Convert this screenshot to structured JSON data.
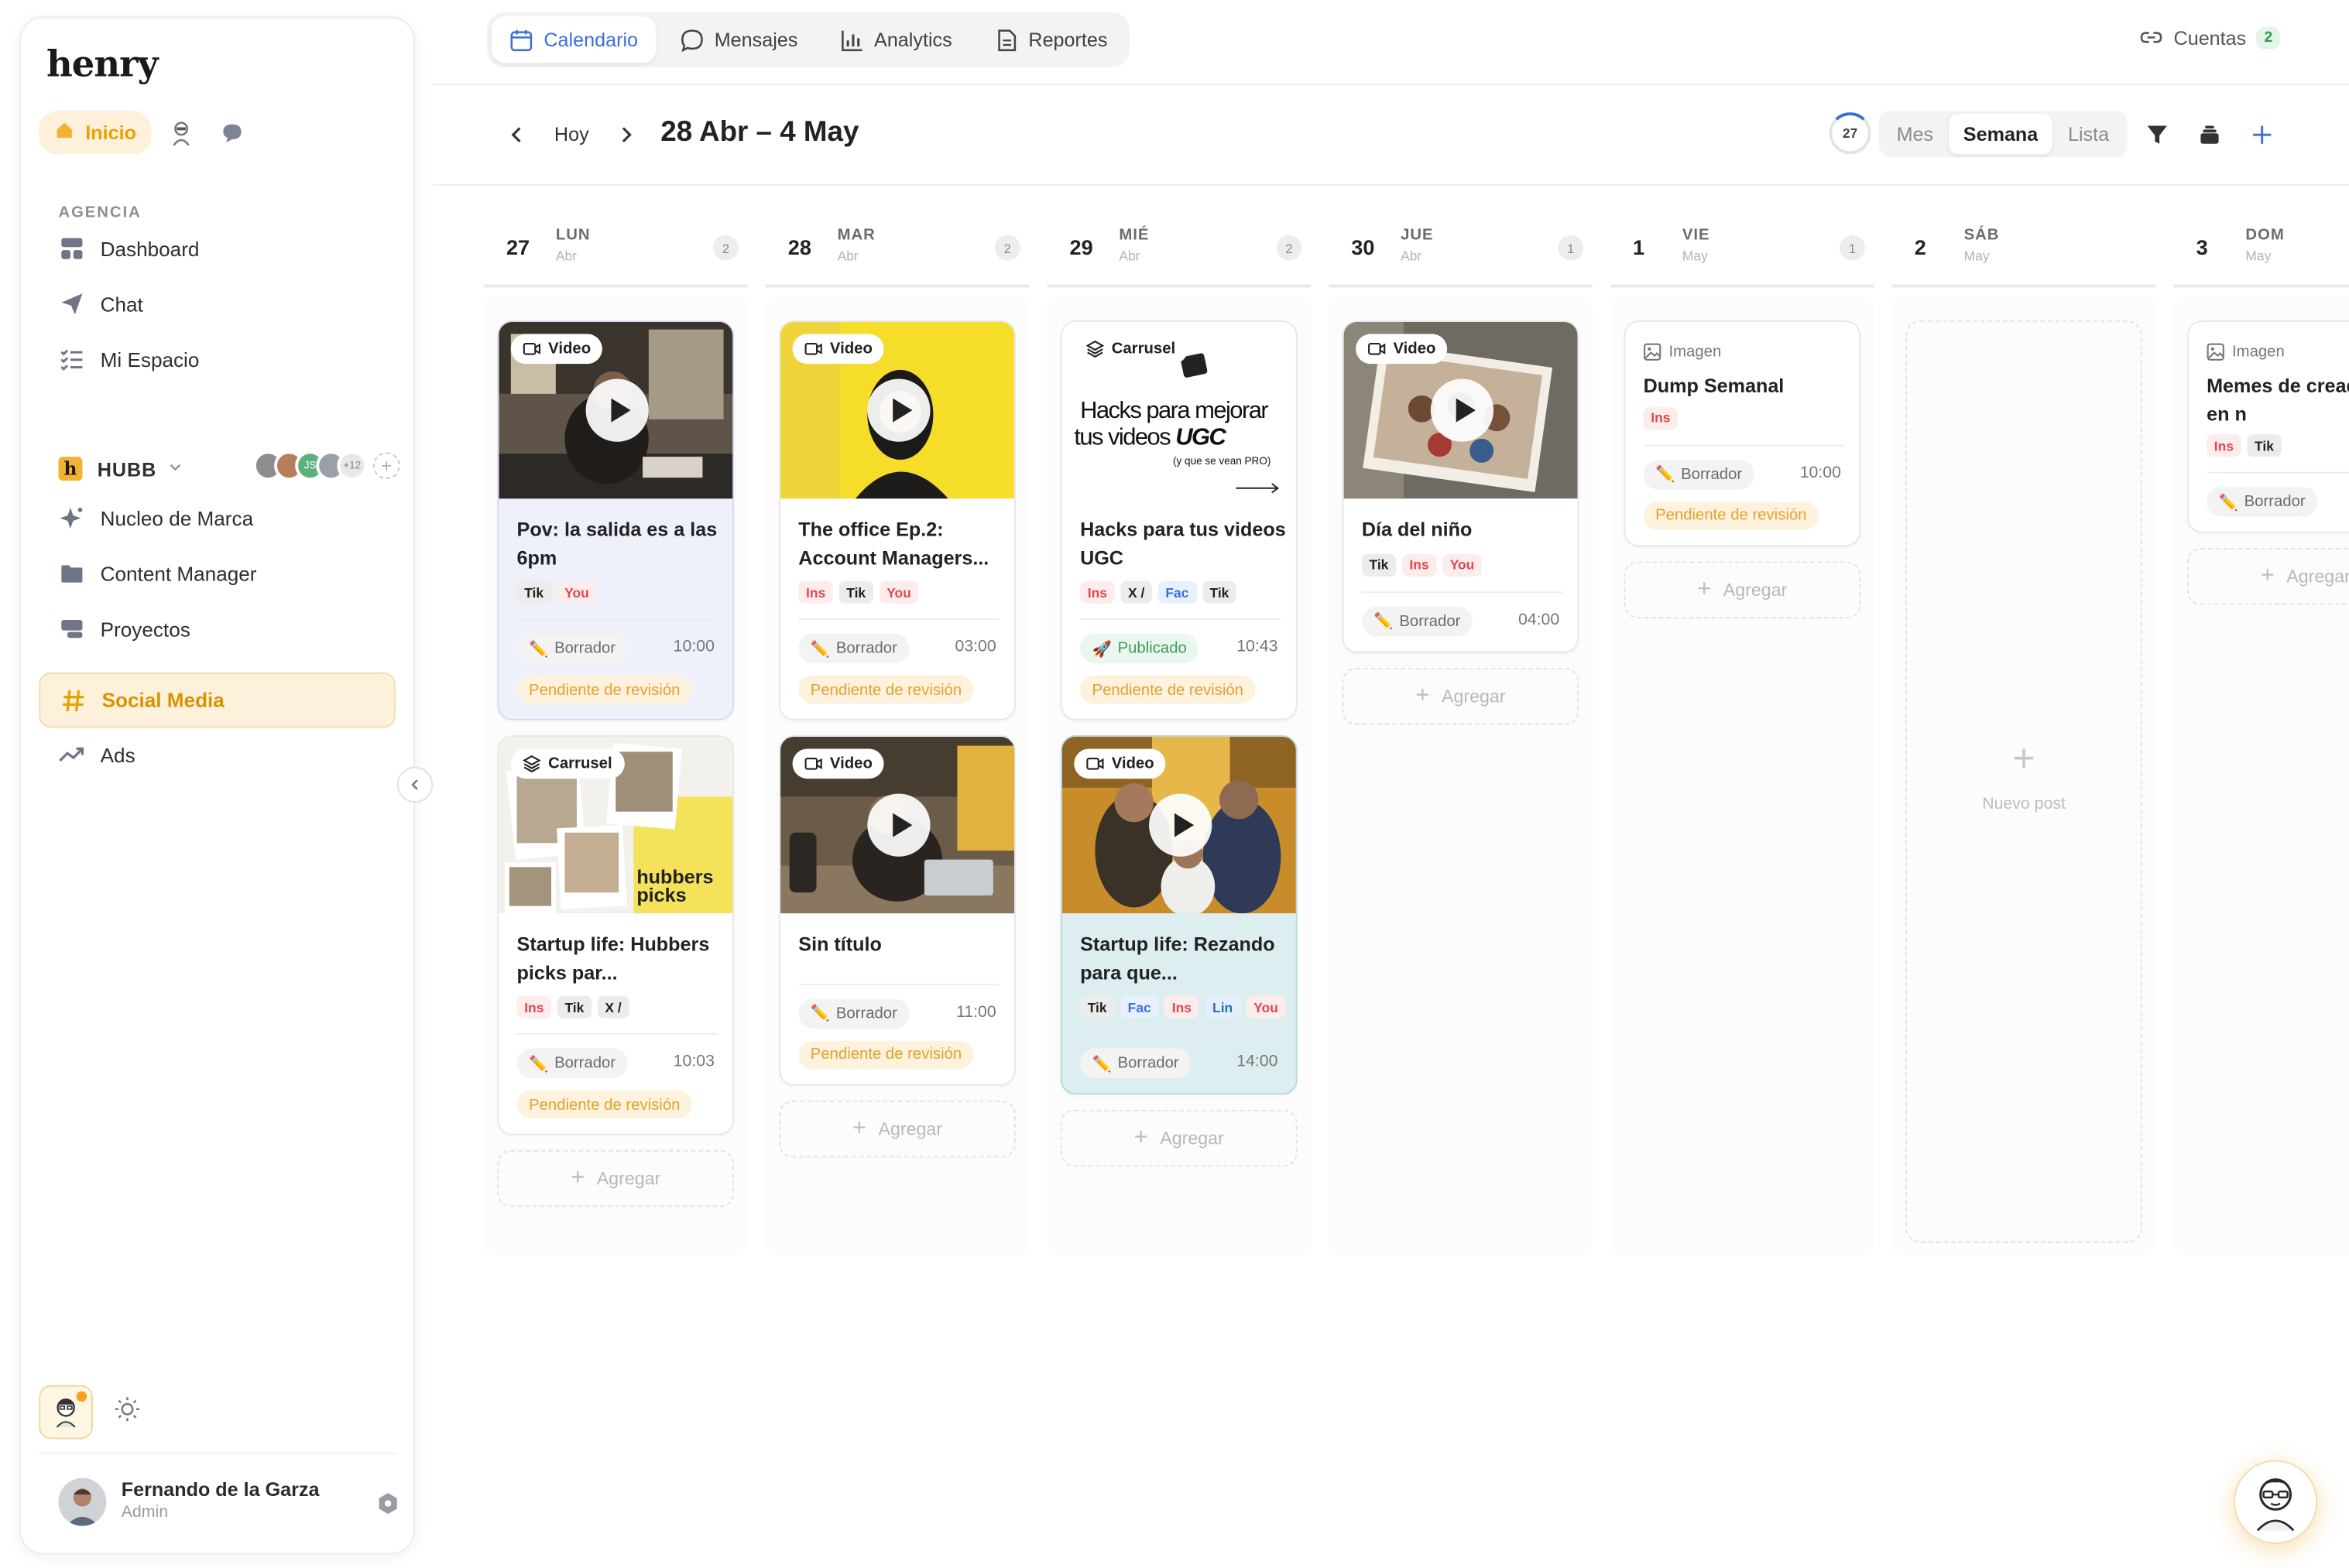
{
  "brand": {
    "logo": "henry",
    "accent": "#e8a200",
    "link_blue": "#3b6fd8"
  },
  "sidebar": {
    "top_tabs": {
      "inicio": "Inicio"
    },
    "section_label": "AGENCIA",
    "agency_items": [
      {
        "label": "Dashboard",
        "icon": "dashboard-icon"
      },
      {
        "label": "Chat",
        "icon": "send-icon"
      },
      {
        "label": "Mi Espacio",
        "icon": "checklist-icon"
      }
    ],
    "workspace": {
      "name": "HUBB",
      "logo_letter": "h",
      "members": [
        "JS",
        "+12"
      ]
    },
    "workspace_items": [
      {
        "label": "Nucleo de Marca",
        "icon": "sparkle-icon"
      },
      {
        "label": "Content Manager",
        "icon": "folder-icon"
      },
      {
        "label": "Proyectos",
        "icon": "projects-icon"
      },
      {
        "label": "Social Media",
        "icon": "hashtag-icon",
        "active": true
      },
      {
        "label": "Ads",
        "icon": "trend-icon"
      }
    ],
    "user": {
      "name": "Fernando de la Garza",
      "role": "Admin"
    }
  },
  "topnav": {
    "tabs": [
      {
        "label": "Calendario",
        "icon": "calendar-icon",
        "active": true
      },
      {
        "label": "Mensajes",
        "icon": "message-icon"
      },
      {
        "label": "Analytics",
        "icon": "bar-chart-icon"
      },
      {
        "label": "Reportes",
        "icon": "document-icon"
      }
    ],
    "cuentas": {
      "label": "Cuentas",
      "count": "2"
    }
  },
  "toolbar": {
    "today": "Hoy",
    "range": "28 Abr – 4 May",
    "circle_day": "27",
    "views": [
      {
        "label": "Mes"
      },
      {
        "label": "Semana",
        "active": true
      },
      {
        "label": "Lista"
      }
    ]
  },
  "calendar": {
    "add_label": "Agregar",
    "new_post_label": "Nuevo post",
    "days": [
      {
        "day": "27",
        "dow": "LUN",
        "month": "Abr",
        "count": "2",
        "posts": [
          {
            "type": "Video",
            "title": "Pov: la salida es a las 6pm",
            "networks": [
              "Tik",
              "You"
            ],
            "status": "Borrador",
            "time": "10:00",
            "review": "Pendiente de revisión",
            "bg": "blue"
          },
          {
            "type": "Carrusel",
            "title": "Startup life: Hubbers picks par...",
            "networks": [
              "Ins",
              "Tik",
              "X /"
            ],
            "status": "Borrador",
            "time": "10:03",
            "review": "Pendiente de revisión",
            "thumb_text": "hubbers picks"
          }
        ]
      },
      {
        "day": "28",
        "dow": "MAR",
        "month": "Abr",
        "count": "2",
        "posts": [
          {
            "type": "Video",
            "title": "The office Ep.2: Account Managers...",
            "networks": [
              "Ins",
              "Tik",
              "You"
            ],
            "status": "Borrador",
            "time": "03:00",
            "review": "Pendiente de revisión"
          },
          {
            "type": "Video",
            "title": "Sin título",
            "networks": [],
            "status": "Borrador",
            "time": "11:00",
            "review": "Pendiente de revisión"
          }
        ]
      },
      {
        "day": "29",
        "dow": "MIÉ",
        "month": "Abr",
        "count": "2",
        "posts": [
          {
            "type": "Carrusel",
            "title": "Hacks para tus videos UGC",
            "networks": [
              "Ins",
              "X /",
              "Fac",
              "Tik"
            ],
            "status": "Publicado",
            "time": "10:43",
            "review": "Pendiente de revisión",
            "thumb_text": "Hacks para mejorar tus videos UGC",
            "thumb_sub": "(y que se vean PRO)"
          },
          {
            "type": "Video",
            "title": "Startup life: Rezando para que...",
            "networks": [
              "Tik",
              "Fac",
              "Ins",
              "Lin",
              "You"
            ],
            "status": "Borrador",
            "time": "14:00",
            "review": "",
            "bg": "teal"
          }
        ]
      },
      {
        "day": "30",
        "dow": "JUE",
        "month": "Abr",
        "count": "1",
        "posts": [
          {
            "type": "Video",
            "title": "Día del niño",
            "networks": [
              "Tik",
              "Ins",
              "You"
            ],
            "status": "Borrador",
            "time": "04:00",
            "review": ""
          }
        ]
      },
      {
        "day": "1",
        "dow": "VIE",
        "month": "May",
        "count": "1",
        "posts": [
          {
            "type": "Imagen",
            "title": "Dump Semanal",
            "networks": [
              "Ins"
            ],
            "status": "Borrador",
            "time": "10:00",
            "review": "Pendiente de revisión"
          }
        ]
      },
      {
        "day": "2",
        "dow": "SÁB",
        "month": "May",
        "count": "",
        "posts": []
      },
      {
        "day": "3",
        "dow": "DOM",
        "month": "May",
        "count": "",
        "posts": [
          {
            "type": "Imagen",
            "title": "Memes de creadores en n",
            "networks": [
              "Ins",
              "Tik"
            ],
            "status": "Borrador",
            "time": "",
            "review": ""
          }
        ]
      }
    ]
  }
}
